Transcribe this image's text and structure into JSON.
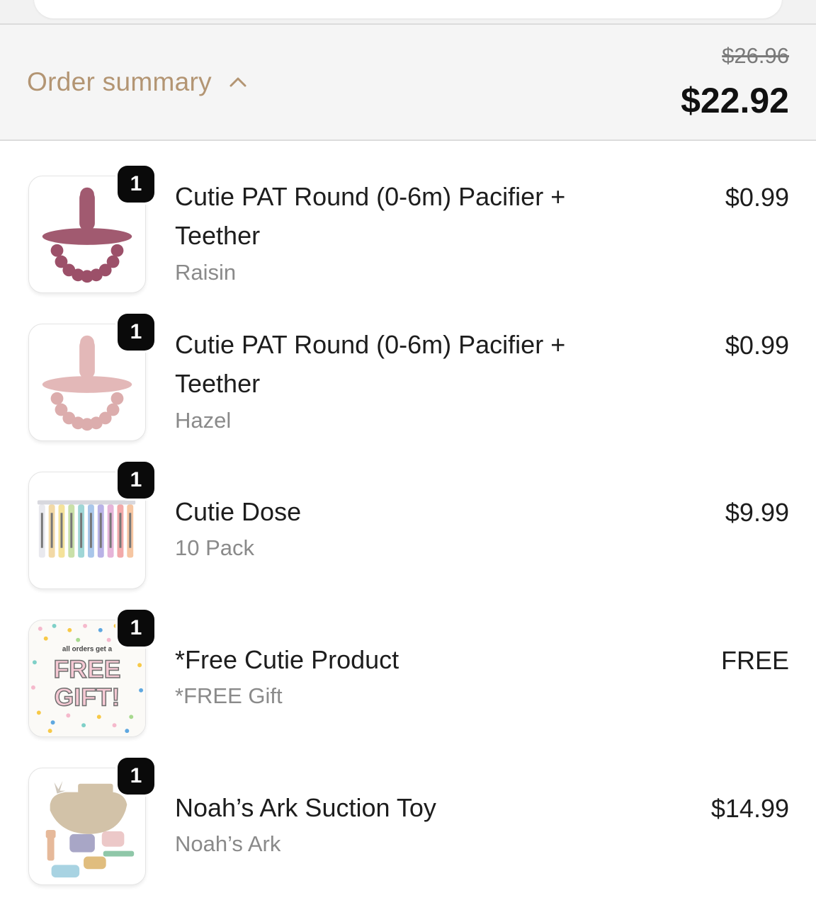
{
  "summary": {
    "label": "Order summary",
    "toggle_icon": "chevron-up-icon",
    "compare_total": "$26.96",
    "total": "$22.92"
  },
  "items": [
    {
      "quantity": "1",
      "title": "Cutie PAT Round (0-6m) Pacifier + Teether",
      "variant": "Raisin",
      "price": "$0.99",
      "image": "raisin-pacifier-image",
      "color": "#a15a70"
    },
    {
      "quantity": "1",
      "title": "Cutie PAT Round (0-6m) Pacifier + Teether",
      "variant": "Hazel",
      "price": "$0.99",
      "image": "hazel-pacifier-image",
      "color": "#e3b8b8"
    },
    {
      "quantity": "1",
      "title": "Cutie Dose",
      "variant": "10 Pack",
      "price": "$9.99",
      "image": "syringe-pack-image"
    },
    {
      "quantity": "1",
      "title": "*Free Cutie Product",
      "variant": "*FREE Gift",
      "price": "FREE",
      "image": "free-gift-image",
      "gift_caption": "all orders get a",
      "gift_line1": "FREE",
      "gift_line2": "GIFT!"
    },
    {
      "quantity": "1",
      "title": "Noah’s Ark Suction Toy",
      "variant": "Noah’s Ark",
      "price": "$14.99",
      "image": "noahs-ark-toy-image"
    }
  ]
}
